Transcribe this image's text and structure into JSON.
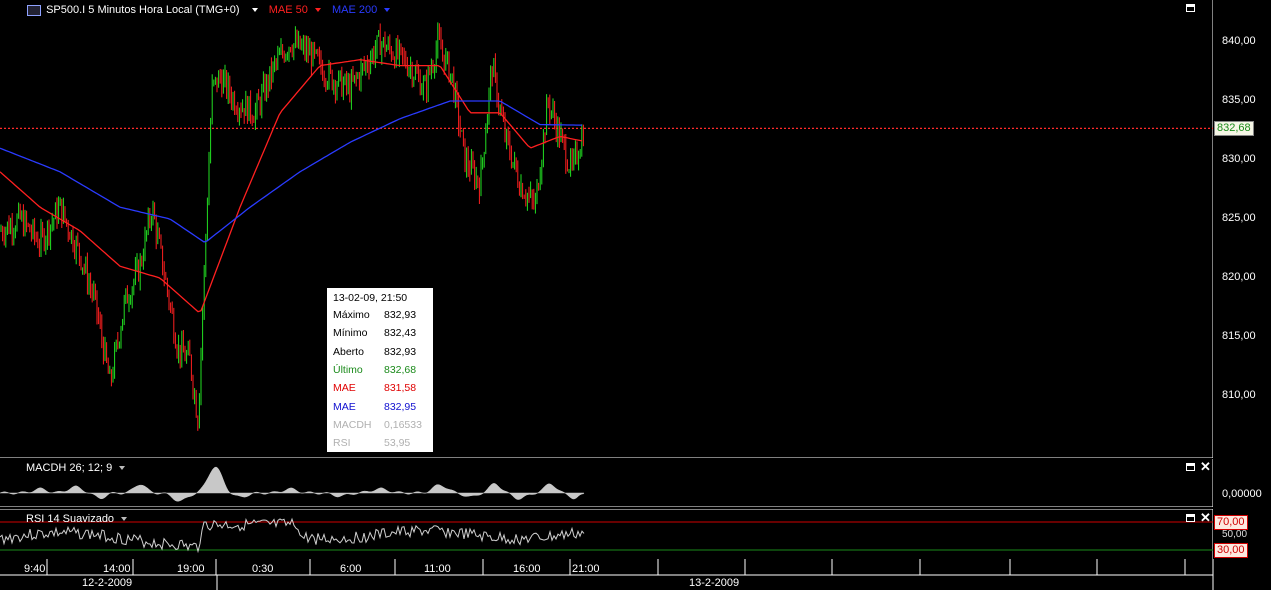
{
  "header": {
    "symbol": "SP500.I",
    "title": "5 Minutos Hora Local (TMG+0)",
    "ind1": "MAE 50",
    "ind2": "MAE 200",
    "colors": {
      "ind1": "#ff2020",
      "ind2": "#2a3bff"
    }
  },
  "price_axis": {
    "labels": [
      "840,00",
      "835,00",
      "830,00",
      "825,00",
      "820,00",
      "815,00",
      "810,00"
    ],
    "current_price": "832,68"
  },
  "tooltip": {
    "datetime": "13-02-09, 21:50",
    "rows": [
      {
        "label": "Máximo",
        "value": "832,93",
        "color": "#000000"
      },
      {
        "label": "Mínimo",
        "value": "832,43",
        "color": "#000000"
      },
      {
        "label": "Aberto",
        "value": "832,93",
        "color": "#000000"
      },
      {
        "label": "Último",
        "value": "832,68",
        "color": "#1a8a1a"
      },
      {
        "label": "MAE",
        "value": "831,58",
        "color": "#e00000"
      },
      {
        "label": "MAE",
        "value": "832,95",
        "color": "#1010d0"
      },
      {
        "label": "MACDH",
        "value": "0,16533",
        "color": "#b0b0b0"
      },
      {
        "label": "RSI",
        "value": "53,95",
        "color": "#b0b0b0"
      }
    ]
  },
  "macd_panel": {
    "title": "MACDH 26; 12; 9",
    "axis_label": "0,00000"
  },
  "rsi_panel": {
    "title": "RSI 14 Suavizado",
    "upper": "70,00",
    "mid": "50,00",
    "lower": "30,00"
  },
  "time_axis": {
    "times": [
      "9:40",
      "14:00",
      "19:00",
      "0:30",
      "6:00",
      "11:00",
      "16:00",
      "21:00"
    ],
    "dates": [
      "12-2-2009",
      "13-2-2009"
    ]
  },
  "chart_data": {
    "type": "candlestick",
    "ylim": [
      806,
      842
    ],
    "price_points": [
      {
        "x": 0,
        "y": 824
      },
      {
        "x": 20,
        "y": 825
      },
      {
        "x": 40,
        "y": 823
      },
      {
        "x": 60,
        "y": 826
      },
      {
        "x": 80,
        "y": 822
      },
      {
        "x": 95,
        "y": 818
      },
      {
        "x": 110,
        "y": 811
      },
      {
        "x": 125,
        "y": 818
      },
      {
        "x": 140,
        "y": 821
      },
      {
        "x": 152,
        "y": 826
      },
      {
        "x": 165,
        "y": 820
      },
      {
        "x": 178,
        "y": 814
      },
      {
        "x": 190,
        "y": 813
      },
      {
        "x": 198,
        "y": 808
      },
      {
        "x": 205,
        "y": 822
      },
      {
        "x": 212,
        "y": 836
      },
      {
        "x": 220,
        "y": 837
      },
      {
        "x": 235,
        "y": 835
      },
      {
        "x": 255,
        "y": 834
      },
      {
        "x": 275,
        "y": 838
      },
      {
        "x": 290,
        "y": 840
      },
      {
        "x": 310,
        "y": 839
      },
      {
        "x": 330,
        "y": 837
      },
      {
        "x": 350,
        "y": 836
      },
      {
        "x": 365,
        "y": 838
      },
      {
        "x": 380,
        "y": 840
      },
      {
        "x": 395,
        "y": 839
      },
      {
        "x": 410,
        "y": 838
      },
      {
        "x": 425,
        "y": 836
      },
      {
        "x": 438,
        "y": 840
      },
      {
        "x": 452,
        "y": 837
      },
      {
        "x": 465,
        "y": 830
      },
      {
        "x": 480,
        "y": 828
      },
      {
        "x": 492,
        "y": 838
      },
      {
        "x": 505,
        "y": 832
      },
      {
        "x": 520,
        "y": 828
      },
      {
        "x": 535,
        "y": 826
      },
      {
        "x": 548,
        "y": 835
      },
      {
        "x": 560,
        "y": 832
      },
      {
        "x": 572,
        "y": 829
      },
      {
        "x": 584,
        "y": 832.68
      }
    ],
    "mae50_points": [
      {
        "x": 0,
        "y": 829
      },
      {
        "x": 40,
        "y": 826
      },
      {
        "x": 80,
        "y": 824
      },
      {
        "x": 120,
        "y": 821
      },
      {
        "x": 160,
        "y": 820
      },
      {
        "x": 200,
        "y": 817
      },
      {
        "x": 240,
        "y": 826
      },
      {
        "x": 280,
        "y": 834
      },
      {
        "x": 320,
        "y": 838
      },
      {
        "x": 360,
        "y": 838.5
      },
      {
        "x": 400,
        "y": 838
      },
      {
        "x": 440,
        "y": 838
      },
      {
        "x": 470,
        "y": 834
      },
      {
        "x": 500,
        "y": 834
      },
      {
        "x": 530,
        "y": 831
      },
      {
        "x": 560,
        "y": 832
      },
      {
        "x": 584,
        "y": 831.58
      }
    ],
    "mae200_points": [
      {
        "x": 0,
        "y": 831
      },
      {
        "x": 60,
        "y": 829
      },
      {
        "x": 120,
        "y": 826
      },
      {
        "x": 170,
        "y": 825
      },
      {
        "x": 205,
        "y": 823
      },
      {
        "x": 250,
        "y": 826
      },
      {
        "x": 300,
        "y": 829
      },
      {
        "x": 350,
        "y": 831.5
      },
      {
        "x": 400,
        "y": 833.5
      },
      {
        "x": 450,
        "y": 835
      },
      {
        "x": 500,
        "y": 835
      },
      {
        "x": 540,
        "y": 833
      },
      {
        "x": 584,
        "y": 832.95
      }
    ],
    "current_price": 832.68
  }
}
